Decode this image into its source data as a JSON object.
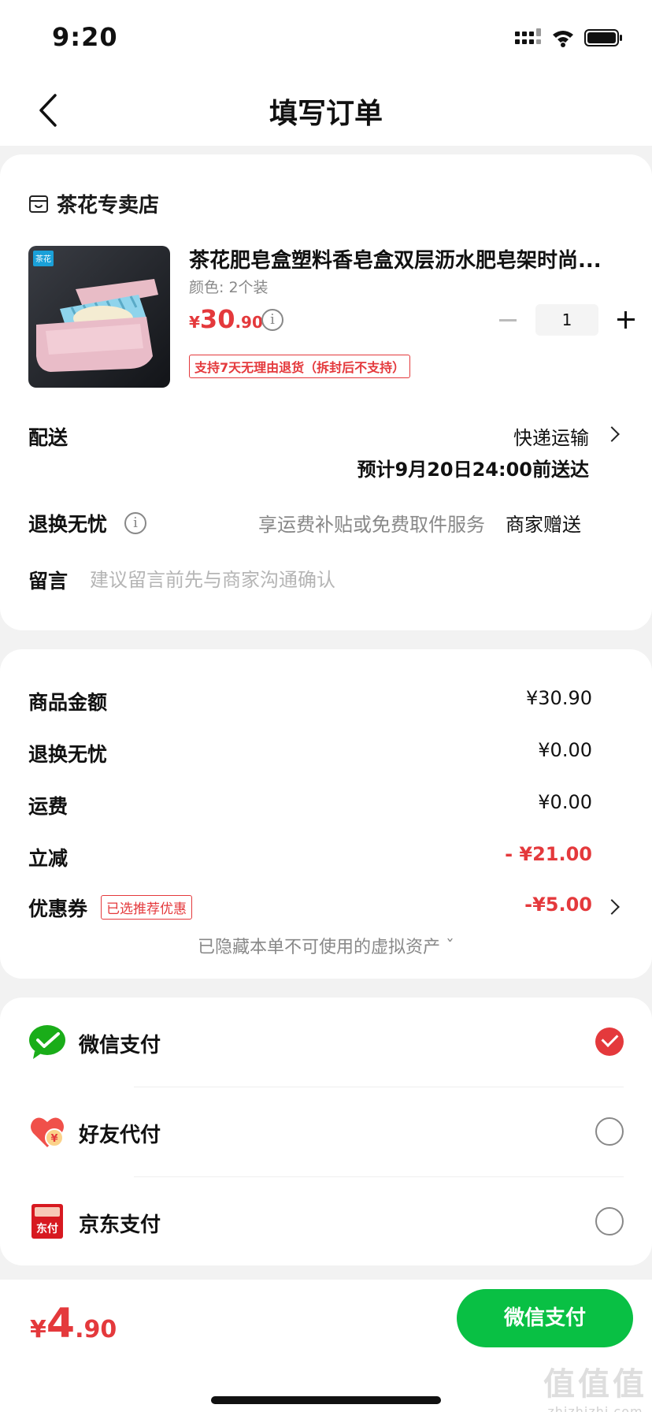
{
  "status_bar": {
    "time": "9:20"
  },
  "nav": {
    "title": "填写订单"
  },
  "shop": {
    "name": "茶花专卖店"
  },
  "product": {
    "title": "茶花肥皂盒塑料香皂盒双层沥水肥皂架时尚...",
    "spec": "颜色: 2个装",
    "price_currency": "¥",
    "price_int": "30",
    "price_dec": ".90",
    "quantity": "1",
    "return_policy": "支持7天无理由退货（拆封后不支持）",
    "image_brand": "茶花"
  },
  "delivery": {
    "label": "配送",
    "method": "快递运输",
    "estimate": "预计9月20日24:00前送达"
  },
  "worry_free": {
    "label": "退换无忧",
    "hint": "享运费补贴或免费取件服务",
    "value": "商家赠送"
  },
  "message": {
    "label": "留言",
    "placeholder": "建议留言前先与商家沟通确认"
  },
  "summary": {
    "goods_label": "商品金额",
    "goods_value": "¥30.90",
    "worry_label": "退换无忧",
    "worry_value": "¥0.00",
    "shipping_label": "运费",
    "shipping_value": "¥0.00",
    "discount_label": "立减",
    "discount_value": "- ¥21.00",
    "coupon_label": "优惠券",
    "coupon_badge": "已选推荐优惠",
    "coupon_value": "-¥5.00",
    "hidden_assets": "已隐藏本单不可使用的虚拟资产 ˇ"
  },
  "payment": {
    "options": [
      {
        "label": "微信支付",
        "icon": "wechat-pay-icon",
        "selected": true
      },
      {
        "label": "好友代付",
        "icon": "friend-pay-icon",
        "selected": false
      },
      {
        "label": "京东支付",
        "icon": "jd-pay-icon",
        "selected": false
      }
    ],
    "jd_icon_text": "东付",
    "friend_icon_text": "¥"
  },
  "bottom": {
    "total_currency": "¥",
    "total_int": "4",
    "total_dec": ".90",
    "pay_button": "微信支付"
  },
  "watermark": {
    "top": "值值值",
    "bottom": "zhizhizhi.com"
  },
  "colors": {
    "accent_red": "#e4393c",
    "wechat_green": "#09c044"
  }
}
